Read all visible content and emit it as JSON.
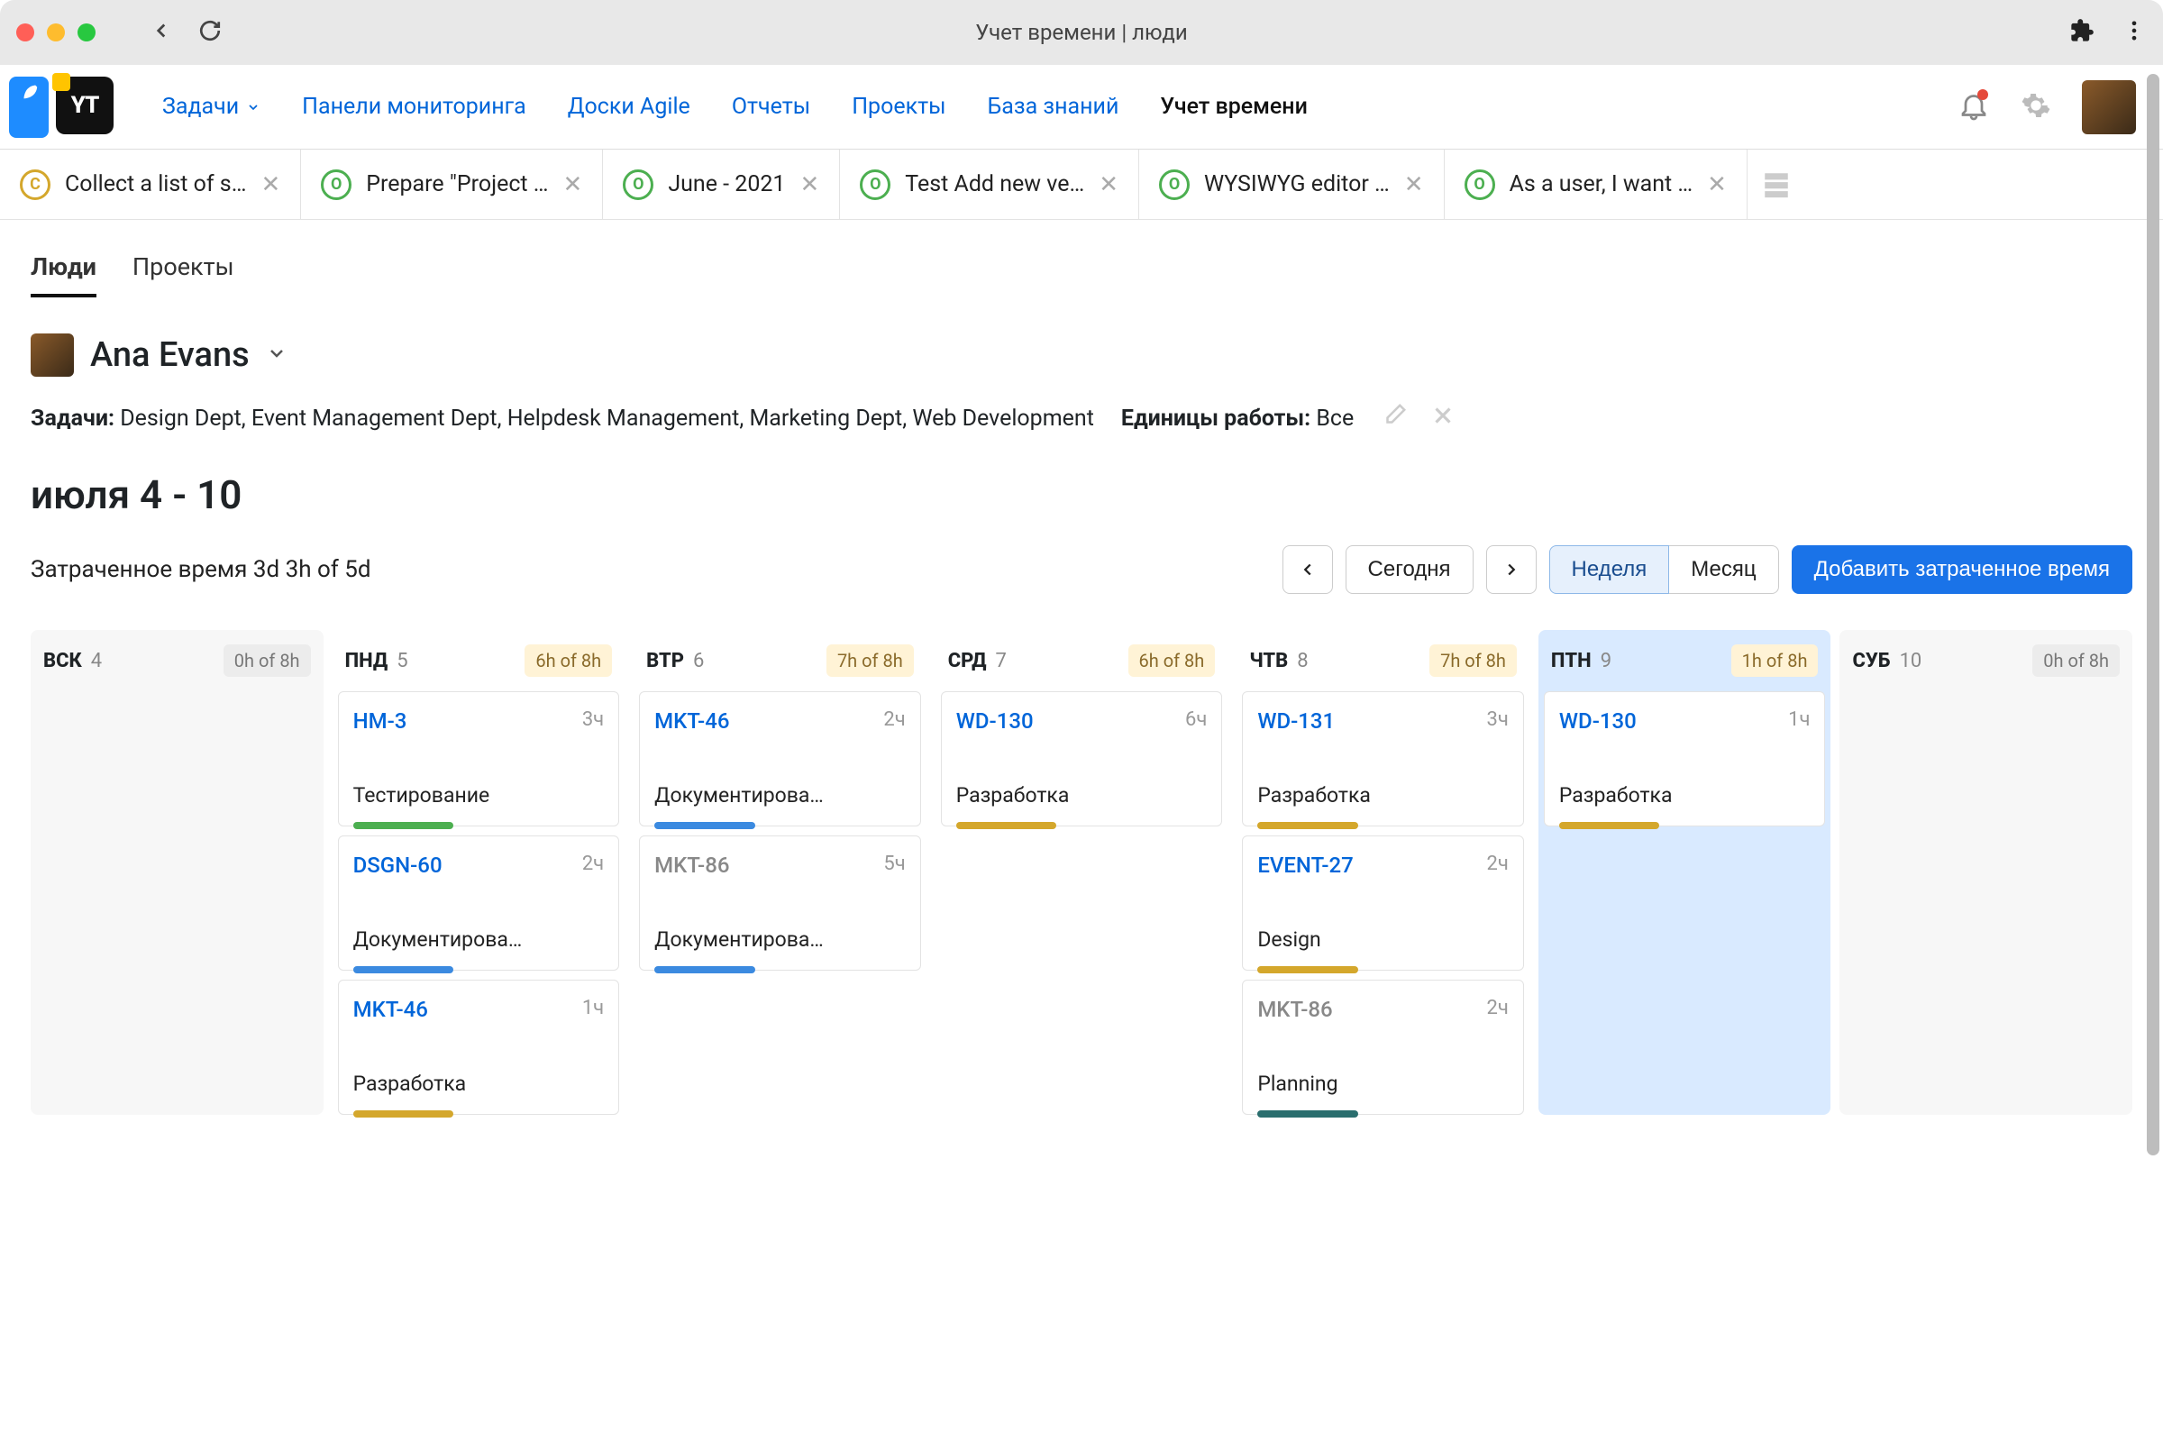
{
  "window": {
    "title": "Учет времени | люди"
  },
  "nav": {
    "links": [
      {
        "label": "Задачи",
        "chevron": true
      },
      {
        "label": "Панели мониторинга"
      },
      {
        "label": "Доски Agile"
      },
      {
        "label": "Отчеты"
      },
      {
        "label": "Проекты"
      },
      {
        "label": "База знаний"
      }
    ],
    "current": "Учет времени"
  },
  "tabs": [
    {
      "icon": "C",
      "color": "amber",
      "label": "Collect a list of s…"
    },
    {
      "icon": "O",
      "color": "green",
      "label": "Prepare \"Project …"
    },
    {
      "icon": "O",
      "color": "green",
      "label": "June - 2021"
    },
    {
      "icon": "O",
      "color": "green",
      "label": "Test Add new ve…"
    },
    {
      "icon": "O",
      "color": "green",
      "label": "WYSIWYG editor …"
    },
    {
      "icon": "O",
      "color": "green",
      "label": "As a user, I want …"
    }
  ],
  "subtabs": {
    "active": "Люди",
    "other": "Проекты"
  },
  "user": {
    "name": "Ana Evans"
  },
  "meta": {
    "tasks_label": "Задачи:",
    "tasks_value": "Design Dept, Event Management Dept, Helpdesk Management, Marketing Dept, Web Development",
    "units_label": "Единицы работы:",
    "units_value": "Все"
  },
  "range": "июля 4 - 10",
  "spent_label": "Затраченное время 3d 3h of 5d",
  "controls": {
    "today": "Сегодня",
    "week": "Неделя",
    "month": "Месяц",
    "add": "Добавить затраченное время"
  },
  "days": [
    {
      "abbr": "ВСК",
      "num": "4",
      "badge": "0h of 8h",
      "off": true,
      "cards": []
    },
    {
      "abbr": "ПНД",
      "num": "5",
      "badge": "6h of 8h",
      "cards": [
        {
          "id": "HM-3",
          "link": true,
          "time": "3ч",
          "type": "Тестирование",
          "bar": "green"
        },
        {
          "id": "DSGN-60",
          "link": true,
          "time": "2ч",
          "type": "Документирова…",
          "bar": "blue"
        },
        {
          "id": "MKT-46",
          "link": true,
          "time": "1ч",
          "type": "Разработка",
          "bar": "amber"
        }
      ]
    },
    {
      "abbr": "ВТР",
      "num": "6",
      "badge": "7h of 8h",
      "cards": [
        {
          "id": "MKT-46",
          "link": true,
          "time": "2ч",
          "type": "Документирова…",
          "bar": "blue"
        },
        {
          "id": "MKT-86",
          "muted": true,
          "time": "5ч",
          "type": "Документирова…",
          "bar": "blue"
        }
      ]
    },
    {
      "abbr": "СРД",
      "num": "7",
      "badge": "6h of 8h",
      "cards": [
        {
          "id": "WD-130",
          "link": true,
          "time": "6ч",
          "type": "Разработка",
          "bar": "amber"
        }
      ]
    },
    {
      "abbr": "ЧТВ",
      "num": "8",
      "badge": "7h of 8h",
      "cards": [
        {
          "id": "WD-131",
          "link": true,
          "time": "3ч",
          "type": "Разработка",
          "bar": "amber"
        },
        {
          "id": "EVENT-27",
          "link": true,
          "time": "2ч",
          "type": "Design",
          "bar": "amber"
        },
        {
          "id": "MKT-86",
          "muted": true,
          "time": "2ч",
          "type": "Planning",
          "bar": "teal"
        }
      ]
    },
    {
      "abbr": "ПТН",
      "num": "9",
      "badge": "1h of 8h",
      "today": true,
      "cards": [
        {
          "id": "WD-130",
          "link": true,
          "time": "1ч",
          "type": "Разработка",
          "bar": "amber"
        }
      ]
    },
    {
      "abbr": "СУБ",
      "num": "10",
      "badge": "0h of 8h",
      "off": true,
      "cards": []
    }
  ]
}
